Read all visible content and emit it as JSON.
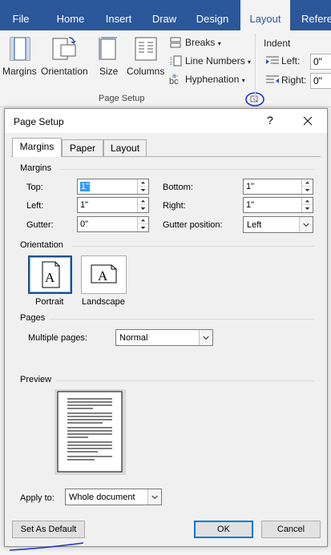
{
  "ribbon": {
    "tabs": [
      {
        "label": "File",
        "active": false
      },
      {
        "label": "Home",
        "active": false
      },
      {
        "label": "Insert",
        "active": false
      },
      {
        "label": "Draw",
        "active": false
      },
      {
        "label": "Design",
        "active": false
      },
      {
        "label": "Layout",
        "active": true
      },
      {
        "label": "Referen",
        "active": false
      }
    ],
    "page_setup_group": {
      "margins_label": "Margins",
      "orientation_label": "Orientation",
      "size_label": "Size",
      "columns_label": "Columns",
      "breaks_label": "Breaks",
      "line_numbers_label": "Line Numbers",
      "hyphenation_label": "Hyphenation",
      "group_label": "Page Setup"
    },
    "indent_group": {
      "title": "Indent",
      "left_label": "Left:",
      "left_value": "0\"",
      "right_label": "Right:",
      "right_value": "0\""
    },
    "accent_color": "#2b579a"
  },
  "dialog": {
    "title": "Page Setup",
    "help_glyph": "?",
    "tabs": [
      {
        "label": "Margins",
        "active": true
      },
      {
        "label": "Paper",
        "active": false
      },
      {
        "label": "Layout",
        "active": false
      }
    ],
    "margins_section": {
      "title": "Margins",
      "top_label": "Top:",
      "top_value": "1\"",
      "bottom_label": "Bottom:",
      "bottom_value": "1\"",
      "left_label": "Left:",
      "left_value": "1\"",
      "right_label": "Right:",
      "right_value": "1\"",
      "gutter_label": "Gutter:",
      "gutter_value": "0\"",
      "gutter_position_label": "Gutter position:",
      "gutter_position_value": "Left"
    },
    "orientation_section": {
      "title": "Orientation",
      "portrait_label": "Portrait",
      "landscape_label": "Landscape",
      "selected": "Portrait"
    },
    "pages_section": {
      "title": "Pages",
      "multiple_pages_label": "Multiple pages:",
      "multiple_pages_value": "Normal"
    },
    "preview_section": {
      "title": "Preview"
    },
    "apply_to_label": "Apply to:",
    "apply_to_value": "Whole document",
    "buttons": {
      "set_default": "Set As Default",
      "ok": "OK",
      "cancel": "Cancel"
    }
  }
}
